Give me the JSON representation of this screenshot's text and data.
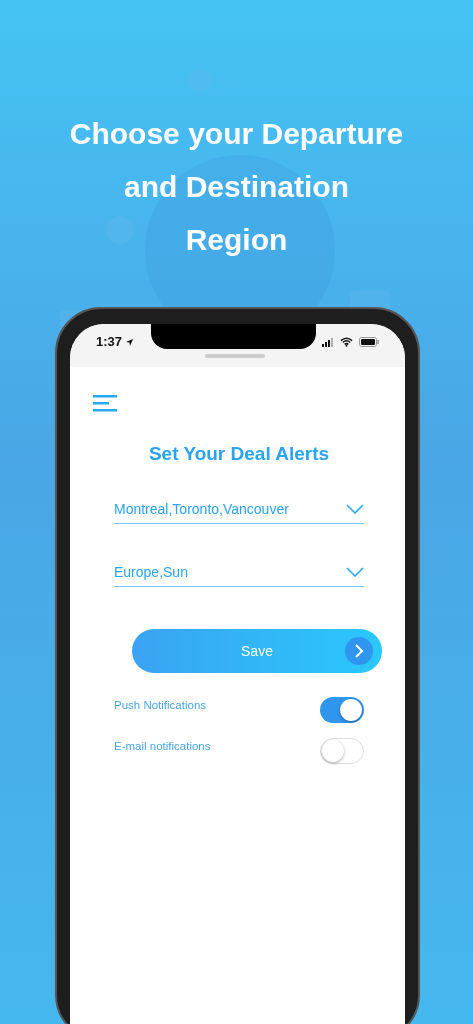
{
  "headline_lines": [
    "Choose your Departure",
    "and Destination",
    "Region"
  ],
  "status_bar": {
    "time": "1:37"
  },
  "screen": {
    "title": "Set Your Deal Alerts",
    "fields": [
      {
        "value": "Montreal,Toronto,Vancouver"
      },
      {
        "value": "Europe,Sun"
      }
    ],
    "save_button": "Save",
    "toggles": [
      {
        "label": "Push Notifications",
        "on": true
      },
      {
        "label": "E-mail notifications",
        "on": false
      }
    ]
  }
}
